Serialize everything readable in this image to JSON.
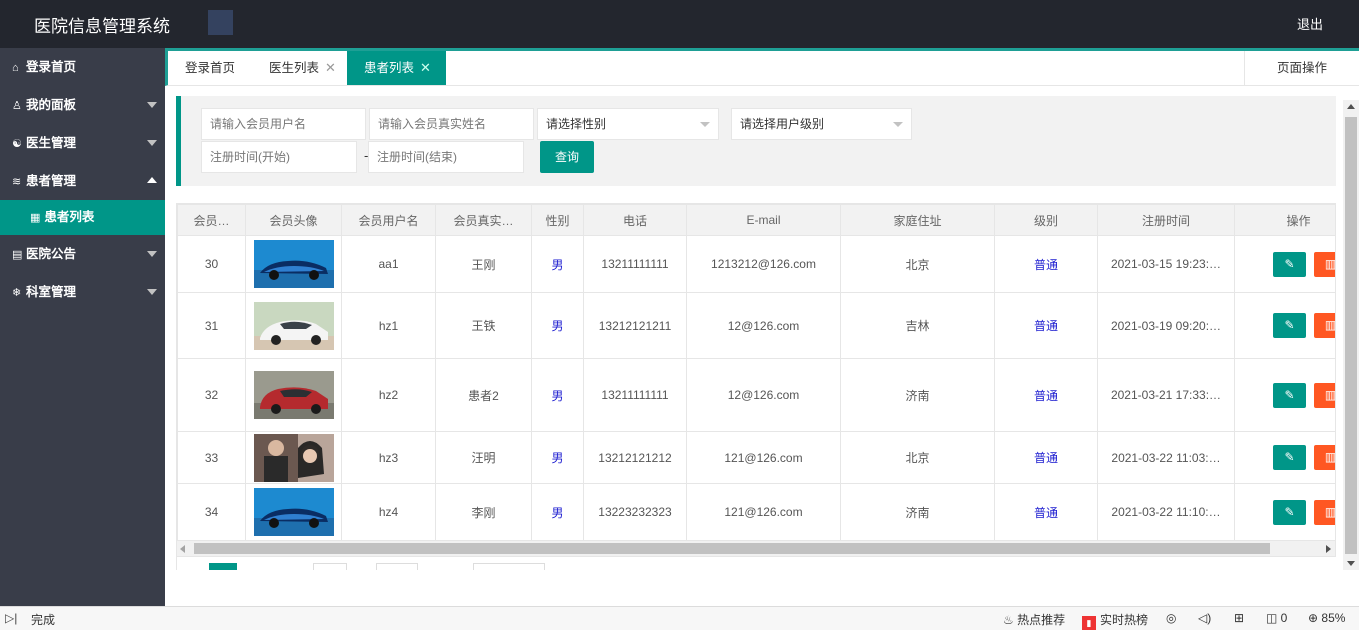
{
  "header": {
    "title": "医院信息管理系统",
    "logout": "退出"
  },
  "sidebar": {
    "items": [
      {
        "label": "登录首页",
        "icon": "home-icon",
        "glyph": "⌂",
        "arrow": ""
      },
      {
        "label": "我的面板",
        "icon": "user-icon",
        "glyph": "♙",
        "arrow": "down"
      },
      {
        "label": "医生管理",
        "icon": "doctor-icon",
        "glyph": "☯",
        "arrow": "down"
      },
      {
        "label": "患者管理",
        "icon": "layers-icon",
        "glyph": "≋",
        "arrow": "up"
      }
    ],
    "sub_item": {
      "label": "患者列表",
      "icon": "list-icon",
      "glyph": "▦"
    },
    "items_after": [
      {
        "label": "医院公告",
        "icon": "notice-icon",
        "glyph": "▤",
        "arrow": "down"
      },
      {
        "label": "科室管理",
        "icon": "snowflake-icon",
        "glyph": "❄",
        "arrow": "down"
      }
    ]
  },
  "tabs": [
    {
      "label": "登录首页",
      "closable": false
    },
    {
      "label": "医生列表",
      "closable": true
    },
    {
      "label": "患者列表",
      "closable": true,
      "active": true
    }
  ],
  "tab_close": "✕",
  "page_ops": "页面操作",
  "search": {
    "username_placeholder": "请输入会员用户名",
    "realname_placeholder": "请输入会员真实姓名",
    "gender_select": "请选择性别",
    "level_select": "请选择用户级别",
    "start_placeholder": "注册时间(开始)",
    "end_placeholder": "注册时间(结束)",
    "dash": "-",
    "query_button": "查询"
  },
  "table": {
    "headers": [
      "会员…",
      "会员头像",
      "会员用户名",
      "会员真实…",
      "性别",
      "电话",
      "E-mail",
      "家庭住址",
      "级别",
      "注册时间",
      "操作"
    ],
    "rows": [
      {
        "id": "30",
        "avatar": "blue-sports-car",
        "username": "aa1",
        "realname": "王刚",
        "gender": "男",
        "phone": "13211111111",
        "email": "1213212@126.com",
        "address": "北京",
        "level": "普通",
        "time": "2021-03-15 19:23:…"
      },
      {
        "id": "31",
        "avatar": "white-sedan",
        "username": "hz1",
        "realname": "王铁",
        "gender": "男",
        "phone": "13212121211",
        "email": "12@126.com",
        "address": "吉林",
        "level": "普通",
        "time": "2021-03-19 09:20:…"
      },
      {
        "id": "32",
        "avatar": "red-suv",
        "username": "hz2",
        "realname": "患者2",
        "gender": "男",
        "phone": "13211111111",
        "email": "12@126.com",
        "address": "济南",
        "level": "普通",
        "time": "2021-03-21 17:33:…"
      },
      {
        "id": "33",
        "avatar": "people-photo",
        "username": "hz3",
        "realname": "汪明",
        "gender": "男",
        "phone": "13212121212",
        "email": "121@126.com",
        "address": "北京",
        "level": "普通",
        "time": "2021-03-22 11:03:…"
      },
      {
        "id": "34",
        "avatar": "blue-sports-car",
        "username": "hz4",
        "realname": "李刚",
        "gender": "男",
        "phone": "13223232323",
        "email": "121@126.com",
        "address": "济南",
        "level": "普通",
        "time": "2021-03-22 11:10:…"
      }
    ],
    "edit_icon": "pencil-icon",
    "delete_icon": "trash-icon"
  },
  "statusbar": {
    "status": "完成",
    "hot_recommend": "热点推荐",
    "realtime_hot": "实时热榜",
    "count": "0",
    "zoom": "85%"
  },
  "colors": {
    "accent": "#009688",
    "header": "#23262e",
    "sidebar": "#393d49",
    "danger": "#ff5722"
  }
}
